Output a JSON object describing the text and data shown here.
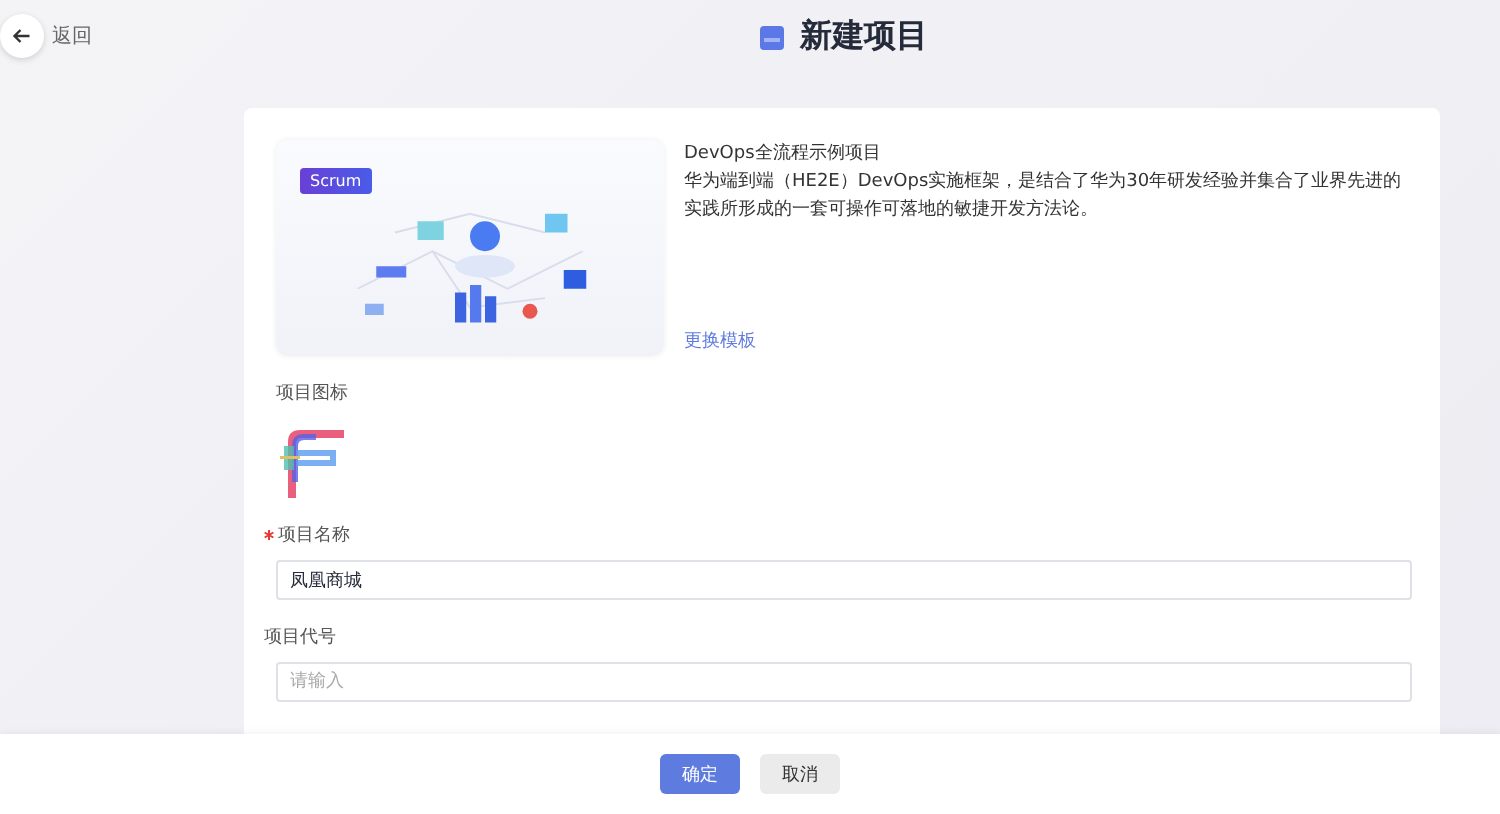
{
  "header": {
    "back_label": "返回",
    "title": "新建项目"
  },
  "template": {
    "badge": "Scrum",
    "name": "DevOps全流程示例项目",
    "description": "华为端到端（HE2E）DevOps实施框架，是结合了华为30年研发经验并集合了业界先进的实践所形成的一套可操作可落地的敏捷开发方法论。",
    "change_link": "更换模板"
  },
  "icon_section": {
    "label": "项目图标"
  },
  "fields": [
    {
      "label": "项目名称",
      "required": true,
      "value": "凤凰商城"
    },
    {
      "label": "项目代号",
      "required": false,
      "placeholder": "请输入"
    }
  ],
  "buttons": [
    {
      "label": "确定",
      "kind": "primary"
    },
    {
      "label": "取消",
      "kind": "secondary"
    }
  ]
}
